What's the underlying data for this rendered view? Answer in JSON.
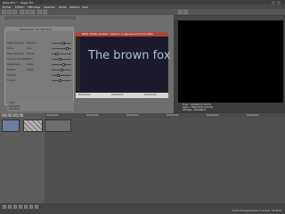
{
  "window": {
    "title": "Sans titre * - Vegas Pro"
  },
  "menus": [
    "Fichier",
    "Edition",
    "Affichage",
    "Insertion",
    "Outils",
    "Options",
    "Aide"
  ],
  "dialog": {
    "title": "Générateur de l'attribut",
    "rows": [
      {
        "label": "Taille de police",
        "value": "Standard"
      },
      {
        "label": "Police",
        "value": "Arial"
      },
      {
        "label": "Style de police",
        "value": "Normal"
      },
      {
        "label": "Couleur du texte",
        "value": "Blanc"
      },
      {
        "label": "Alignement",
        "value": "Centre"
      },
      {
        "label": "Position",
        "value": "Centre"
      },
      {
        "label": "Contour",
        "value": ""
      },
      {
        "label": "Ombre",
        "value": ""
      }
    ]
  },
  "preview": {
    "header": "Média d'édition de texte : cliquez ici ou appuyez sur F2 pour éditer",
    "text": "The brown fox",
    "ruler_labels": [
      "00:00:00;00",
      "00:00:05;00",
      "00:00:10;00"
    ]
  },
  "left_bottom": {
    "rows": [
      "Projet",
      "Explorateur",
      "Transitions"
    ]
  },
  "right": {
    "labels": [
      "Projet : 720x480x32, 29,970i",
      "Aperçu : 180x120x32, 29,970p",
      "Affichage : 302x188x32"
    ]
  },
  "timeline": {
    "timecode": "00:00:00;00",
    "marks": [
      "00:00:00;00",
      "00:00:10;00",
      "00:00:20;00",
      "00:00:30;00",
      "00:00:40;00",
      "00:00:50;00"
    ]
  },
  "status": {
    "text": "Durée d'enregistrement (2 canaux) : 40:49:05"
  }
}
